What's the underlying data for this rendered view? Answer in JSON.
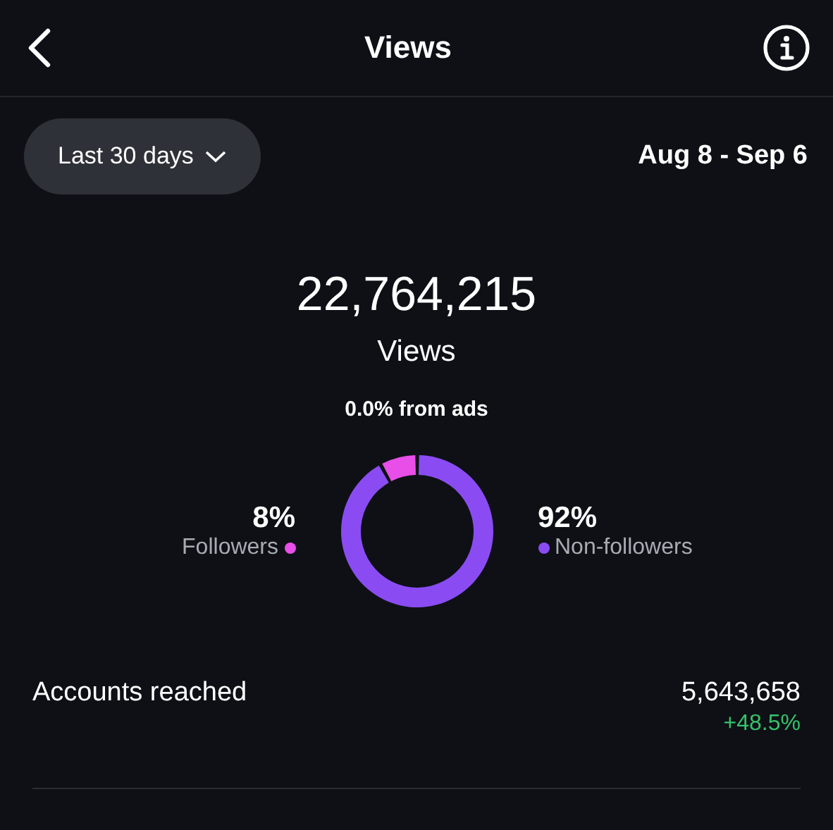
{
  "header": {
    "title": "Views"
  },
  "filter": {
    "range": "Last 30 days",
    "dates": "Aug 8 - Sep 6"
  },
  "summary": {
    "total": "22,764,215",
    "label": "Views",
    "ads": "0.0% from ads"
  },
  "split": [
    {
      "percent": "8%",
      "color": "#e84ee8"
    },
    {
      "percent": "92%",
      "color": "#8a4cf2"
    }
  ],
  "chart_data": {
    "type": "donut",
    "categories": [
      "Followers",
      "Non-followers"
    ],
    "values": [
      8,
      92
    ]
  },
  "metrics": [
    {
      "label": "Accounts reached",
      "value": "5,643,658",
      "change": "+48.5%"
    }
  ]
}
